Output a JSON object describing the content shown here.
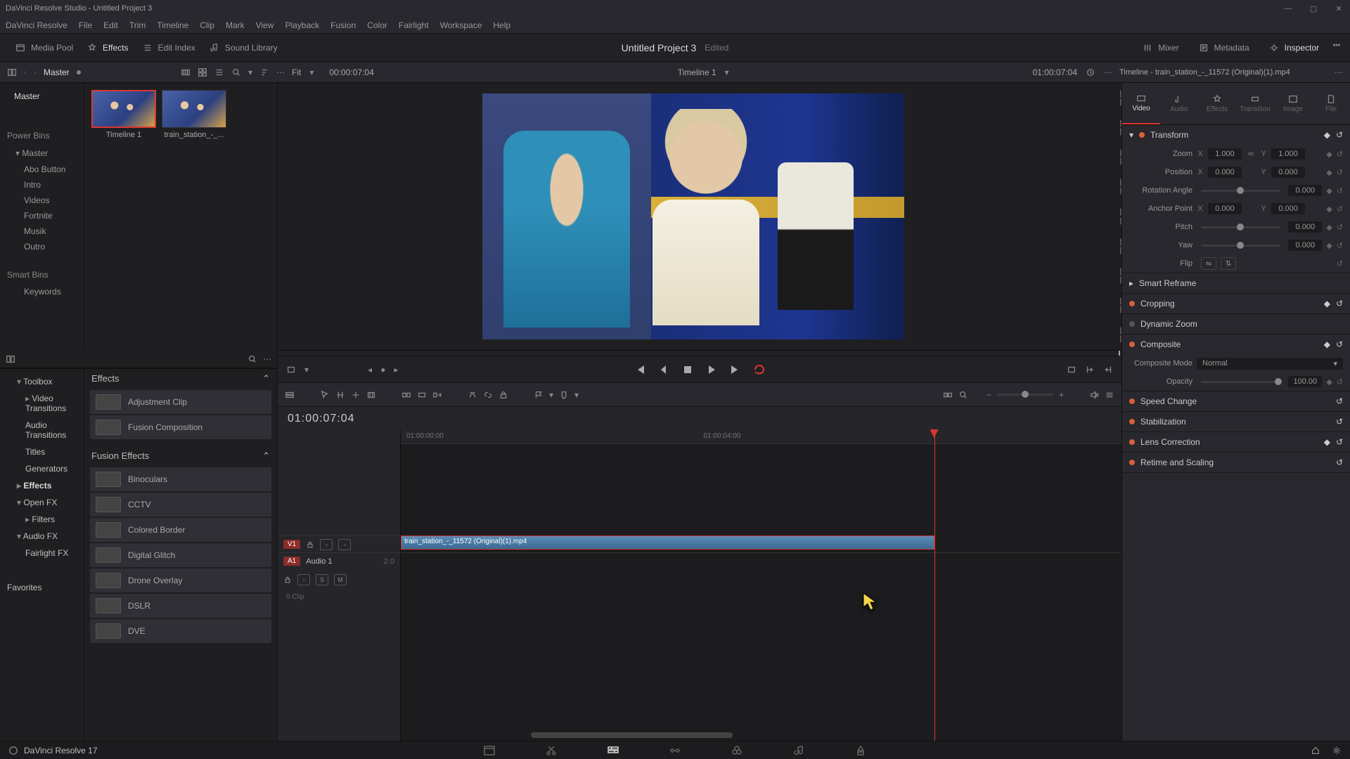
{
  "titlebar": "DaVinci Resolve Studio - Untitled Project 3",
  "menu": [
    "DaVinci Resolve",
    "File",
    "Edit",
    "Trim",
    "Timeline",
    "Clip",
    "Mark",
    "View",
    "Playback",
    "Fusion",
    "Color",
    "Fairlight",
    "Workspace",
    "Help"
  ],
  "toolbar": {
    "media_pool": "Media Pool",
    "effects": "Effects",
    "edit_index": "Edit Index",
    "sound_library": "Sound Library",
    "mixer": "Mixer",
    "metadata": "Metadata",
    "inspector": "Inspector"
  },
  "project": {
    "title": "Untitled Project 3",
    "edited": "Edited"
  },
  "secbar": {
    "master": "Master",
    "fit": "Fit",
    "tc_left": "00:00:07:04",
    "timeline_name": "Timeline 1",
    "tc_right": "01:00:07:04",
    "inspector_title": "Timeline - train_station_-_11572 (Original)(1).mp4"
  },
  "bins": {
    "master": "Master",
    "power": "Power Bins",
    "power_master": "Master",
    "power_items": [
      "Abo Button",
      "Intro",
      "Videos",
      "Fortnite",
      "Musik",
      "Outro"
    ],
    "smart": "Smart Bins",
    "keywords": "Keywords"
  },
  "toolbox": {
    "header": "Toolbox",
    "items": [
      "Video Transitions",
      "Audio Transitions",
      "Titles",
      "Generators"
    ],
    "effects": "Effects",
    "openfx": "Open FX",
    "filters": "Filters",
    "audiofx": "Audio FX",
    "fairlight": "Fairlight FX",
    "favorites": "Favorites"
  },
  "fx": {
    "effects_header": "Effects",
    "effects_items": [
      "Adjustment Clip",
      "Fusion Composition"
    ],
    "fusion_header": "Fusion Effects",
    "fusion_items": [
      "Binoculars",
      "CCTV",
      "Colored Border",
      "Digital Glitch",
      "Drone Overlay",
      "DSLR",
      "DVE"
    ]
  },
  "thumbs": [
    {
      "label": "Timeline 1",
      "selected": true
    },
    {
      "label": "train_station_-_...",
      "selected": false
    }
  ],
  "timeline": {
    "timecode": "01:00:07:04",
    "ruler": [
      "01:00:00:00",
      "01:00:04:00"
    ],
    "v1": "V1",
    "a1": "A1",
    "audio_name": "Audio 1",
    "audio_ch": "2.0",
    "audio_clips": "0 Clip",
    "s": "S",
    "m": "M",
    "clip_name": "train_station_-_11572 (Original)(1).mp4"
  },
  "inspector": {
    "tabs": [
      "Video",
      "Audio",
      "Effects",
      "Transition",
      "Image",
      "File"
    ],
    "transform": "Transform",
    "zoom": "Zoom",
    "zx": "1.000",
    "zy": "1.000",
    "position": "Position",
    "px": "0.000",
    "py": "0.000",
    "rotation": "Rotation Angle",
    "rot": "0.000",
    "anchor": "Anchor Point",
    "ax": "0.000",
    "ay": "0.000",
    "pitch": "Pitch",
    "pv": "0.000",
    "yaw": "Yaw",
    "yv": "0.000",
    "flip": "Flip",
    "smart_reframe": "Smart Reframe",
    "cropping": "Cropping",
    "dynamic_zoom": "Dynamic Zoom",
    "composite": "Composite",
    "composite_mode": "Composite Mode",
    "composite_mode_val": "Normal",
    "opacity": "Opacity",
    "opacity_val": "100.00",
    "speed": "Speed Change",
    "stabilization": "Stabilization",
    "lens": "Lens Correction",
    "retime": "Retime and Scaling"
  },
  "bottombar": {
    "version": "DaVinci Resolve 17"
  }
}
